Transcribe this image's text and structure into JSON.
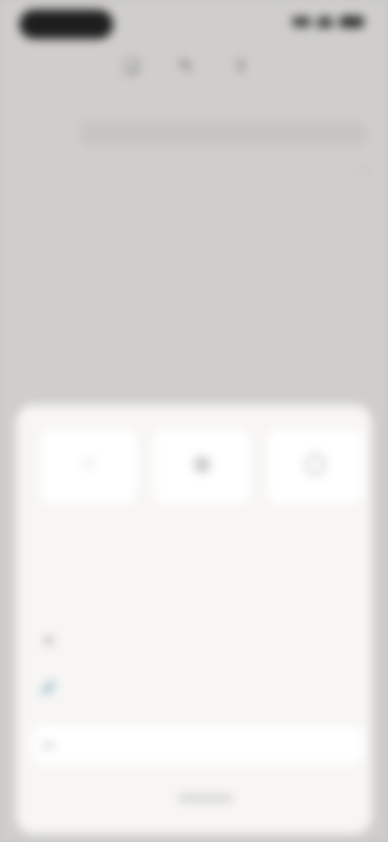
{
  "status_bar": {
    "time": "",
    "signal_icon": "cellular-signal-icon",
    "wifi_icon": "wifi-icon",
    "battery_icon": "battery-icon"
  },
  "toolbar": {
    "icons": [
      {
        "name": "bookmark-icon",
        "glyph": "❏"
      },
      {
        "name": "compose-icon",
        "glyph": "✎"
      },
      {
        "name": "share-icon",
        "glyph": "⇪"
      }
    ]
  },
  "browser": {
    "url": ""
  },
  "article": {
    "meta_left": "",
    "meta_right": "",
    "title": "",
    "body": "",
    "section_label": ""
  },
  "share_sheet": {
    "tiles": [
      {
        "icon": "user-icon",
        "glyph": "◌",
        "label": ""
      },
      {
        "icon": "microphone-icon",
        "glyph": "◍",
        "label": ""
      },
      {
        "icon": "contact-icon",
        "glyph": "◯",
        "label": ""
      }
    ],
    "subtitle": "",
    "hint": "",
    "actions": [
      {
        "icon": "copy-icon",
        "glyph": "⧉",
        "label": ""
      },
      {
        "icon": "link-icon",
        "glyph": "🔗",
        "label": ""
      },
      {
        "icon": "folder-icon",
        "glyph": "▭",
        "label": ""
      }
    ]
  }
}
